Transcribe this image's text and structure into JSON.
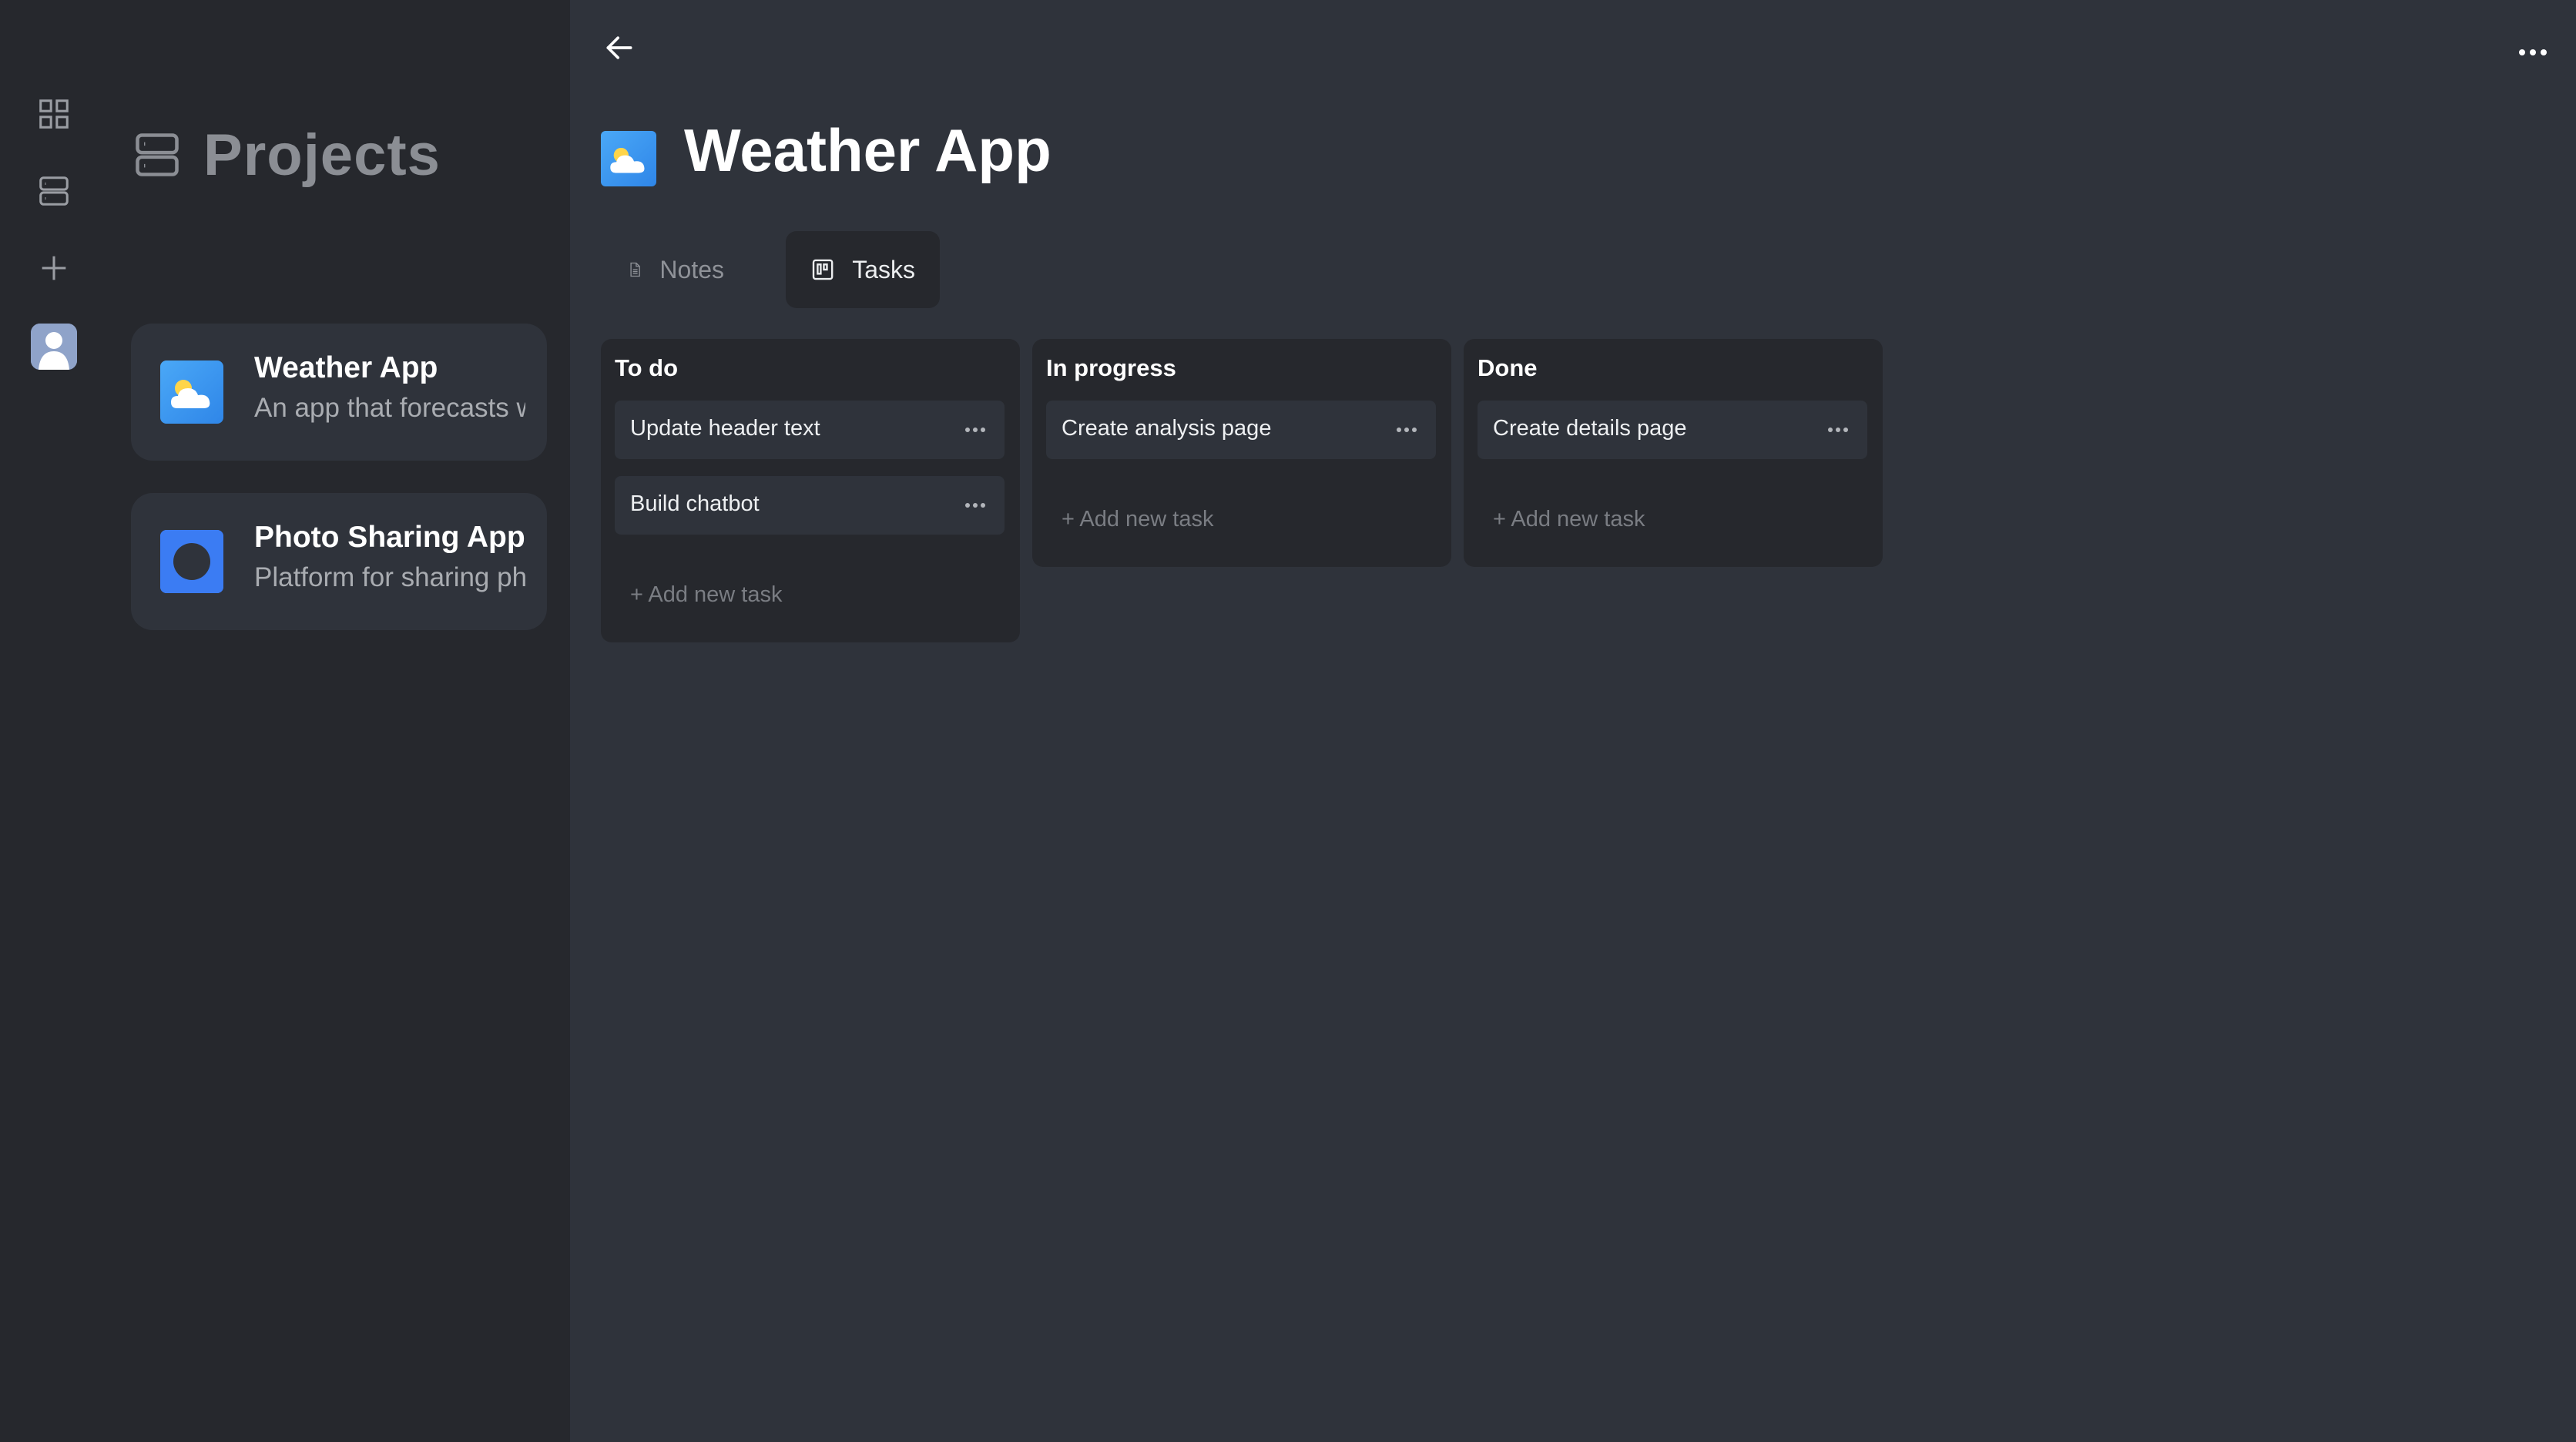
{
  "sidebar": {
    "title": "Projects",
    "projects": [
      {
        "name": "Weather App",
        "description": "An app that forecasts weather"
      },
      {
        "name": "Photo Sharing App",
        "description": "Platform for sharing photos"
      }
    ]
  },
  "main": {
    "title": "Weather App",
    "tabs": [
      {
        "label": "Notes",
        "icon": "document-icon"
      },
      {
        "label": "Tasks",
        "icon": "kanban-icon",
        "active": true
      }
    ]
  },
  "board": {
    "add_label": "+ Add new task",
    "columns": [
      {
        "title": "To do",
        "tasks": [
          "Update header text",
          "Build chatbot"
        ]
      },
      {
        "title": "In progress",
        "tasks": [
          "Create analysis page"
        ]
      },
      {
        "title": "Done",
        "tasks": [
          "Create details page"
        ]
      }
    ]
  },
  "colors": {
    "background": "#2f333b",
    "sidebar": "#26282d",
    "card": "#2f333b",
    "text_primary": "#ffffff",
    "text_muted": "#8b8e94",
    "photo_icon": "#3b7cf3"
  }
}
